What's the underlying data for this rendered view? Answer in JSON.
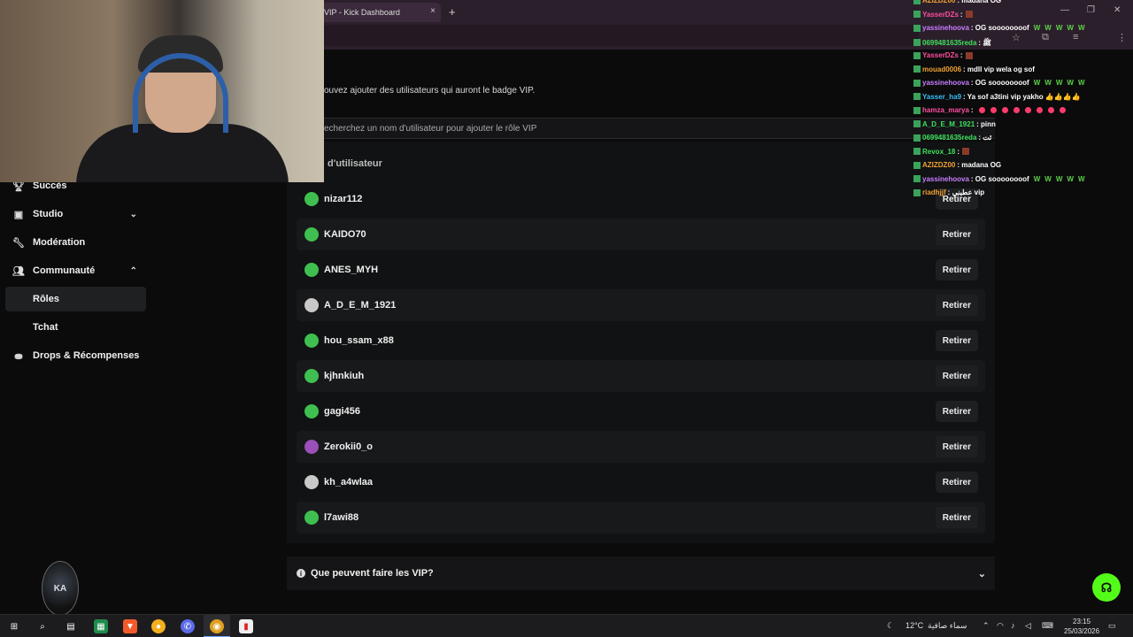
{
  "browser": {
    "tab_title": "VIP - Kick Dashboard",
    "tab_close": "×",
    "new_tab": "+",
    "window_controls": [
      "—",
      "❐",
      "✕"
    ]
  },
  "sidebar": {
    "items": [
      {
        "label": "Succès",
        "icon": "trophy-icon"
      },
      {
        "label": "Studio",
        "icon": "video-icon",
        "chevron": "chevron-down"
      },
      {
        "label": "Modération",
        "icon": "wrench-icon"
      },
      {
        "label": "Communauté",
        "icon": "users-icon",
        "chevron": "chevron-up"
      },
      {
        "label": "Rôles"
      },
      {
        "label": "Tchat"
      },
      {
        "label": "Drops & Récompenses",
        "icon": "gift-icon"
      }
    ],
    "logo_text": "KA"
  },
  "main": {
    "intro": "ouvez ajouter des utilisateurs qui auront le badge VIP.",
    "search_placeholder": "echerchez un nom d'utilisateur pour ajouter le rôle VIP",
    "column_header": "d'utilisateur",
    "remove_label": "Retirer",
    "users": [
      {
        "name": "nizar112",
        "avatar": "green"
      },
      {
        "name": "KAIDO70",
        "avatar": "green"
      },
      {
        "name": "ANES_MYH",
        "avatar": "green"
      },
      {
        "name": "A_D_E_M_1921",
        "avatar": "grey"
      },
      {
        "name": "hou_ssam_x88",
        "avatar": "green"
      },
      {
        "name": "kjhnkiuh",
        "avatar": "green"
      },
      {
        "name": "gagi456",
        "avatar": "green"
      },
      {
        "name": "Zerokii0_o",
        "avatar": "purple"
      },
      {
        "name": "kh_a4wlaa",
        "avatar": "grey"
      },
      {
        "name": "l7awi88",
        "avatar": "green"
      }
    ],
    "faq_title": "Que peuvent faire les VIP?"
  },
  "chat": {
    "lines": [
      {
        "user": "AZIZDZ00",
        "color": "#f0a030",
        "text": ": madana OG"
      },
      {
        "user": "YasserDZs",
        "color": "#ff4fa0",
        "text": ":",
        "emote": true
      },
      {
        "user": "yassinehoova",
        "color": "#c77dff",
        "text": ": OG soooooooof",
        "w": 5
      },
      {
        "user": "0699481635reda",
        "color": "#3de05a",
        "text": ": ﷺ"
      },
      {
        "user": "YasserDZs",
        "color": "#ff4fa0",
        "text": ":",
        "emote": true
      },
      {
        "user": "mouad0006",
        "color": "#f0a030",
        "text": ": mdll vip wela og sof"
      },
      {
        "user": "yassinehoova",
        "color": "#c77dff",
        "text": ": OG soooooooof",
        "w": 5
      },
      {
        "user": "Yasser_ha9",
        "color": "#38bdf8",
        "text": ": Ya sof a3tini vip yakho 👍👍👍👍"
      },
      {
        "user": "hamza_marya",
        "color": "#ff4fa0",
        "text": ":",
        "pink": true
      },
      {
        "user": "A_D_E_M_1921",
        "color": "#3de05a",
        "text": ": pinn"
      },
      {
        "user": "0699481635reda",
        "color": "#3de05a",
        "text": ": ئت"
      },
      {
        "user": "Revox_18",
        "color": "#3de05a",
        "text": ":",
        "emote": true
      },
      {
        "user": "AZIZDZ00",
        "color": "#f0a030",
        "text": ": madana OG"
      },
      {
        "user": "yassinehoova",
        "color": "#c77dff",
        "text": ": OG soooooooof",
        "w": 5
      },
      {
        "user": "riadhjjf",
        "color": "#f0a030",
        "text": ": عطيني vip"
      }
    ],
    "w_glyph": "W"
  },
  "taskbar": {
    "weather": "12°C",
    "weather_desc": "سماء صافية",
    "time": "23:15",
    "date": "25/03/2026"
  }
}
